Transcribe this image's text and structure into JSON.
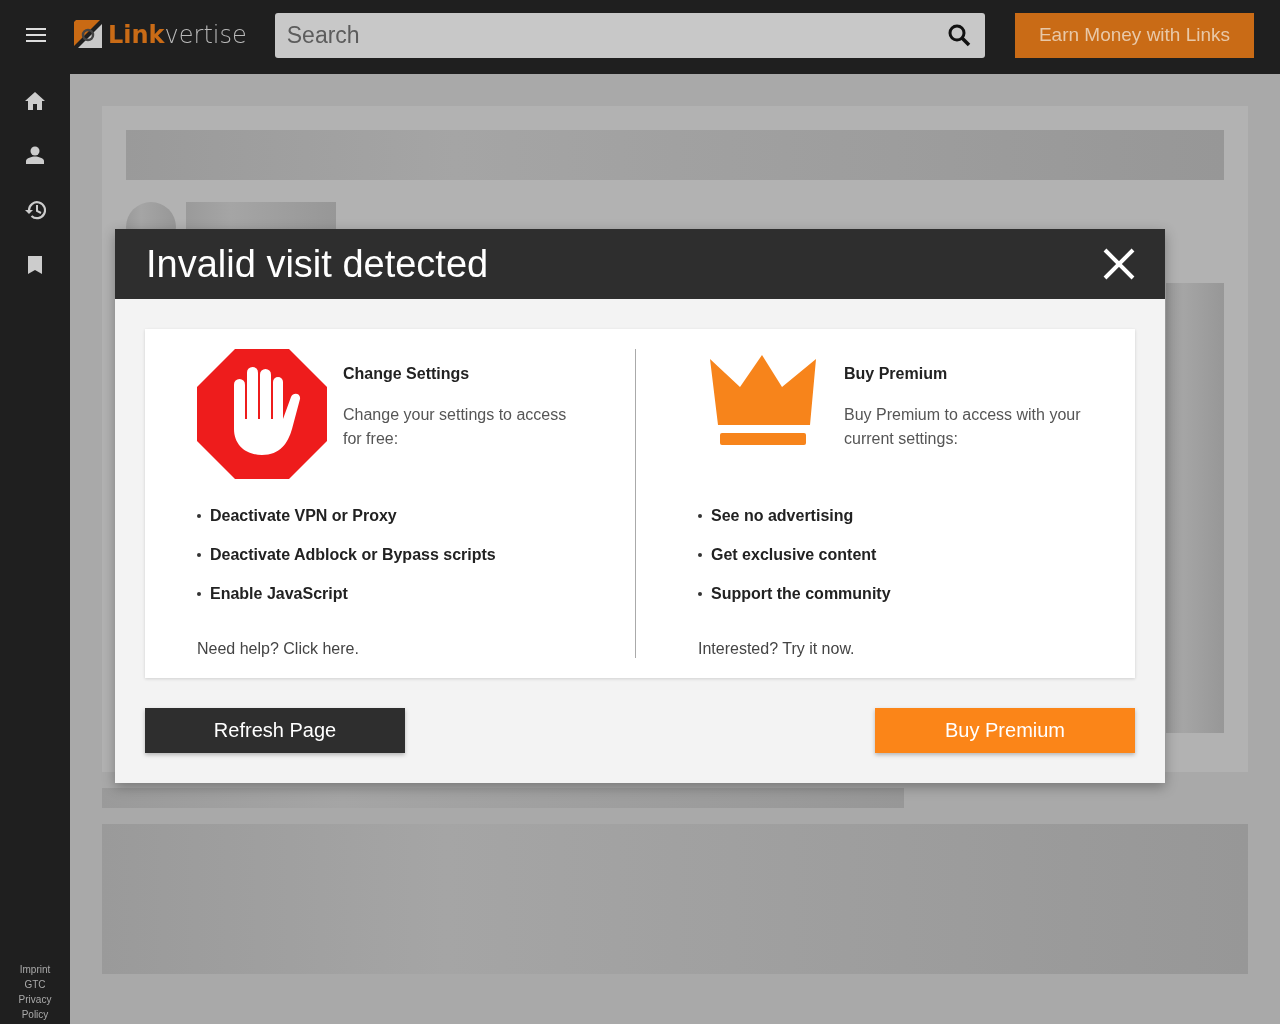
{
  "header": {
    "logo": "**Link**vertise",
    "search": {
      "placeholder": "Search"
    },
    "cta": "Earn Money with Links"
  },
  "sidebar": {
    "items": [
      {
        "kind": "home"
      },
      {
        "kind": "profile"
      },
      {
        "kind": "history"
      },
      {
        "kind": "bookmark"
      }
    ],
    "footer_links": [
      "Imprint",
      "GTC",
      "Privacy Policy"
    ]
  },
  "dialog": {
    "title": "Invalid visit detected",
    "options": [
      {
        "kind": "stop",
        "heading": "Change Settings",
        "text": "Change your settings to access for free:",
        "bullets": [
          "Deactivate VPN or Proxy",
          "Deactivate Adblock or Bypass scripts",
          "Enable JavaScript"
        ],
        "footer": "Need help? Click here."
      },
      {
        "kind": "crown",
        "heading": "Buy Premium",
        "text": "Buy Premium to access with your current settings:",
        "bullets": [
          "See no advertising",
          "Get exclusive content",
          "Support the community"
        ],
        "footer": "Interested? Try it now."
      }
    ],
    "buttons": [
      {
        "kind": "dark",
        "label": "Refresh Page"
      },
      {
        "kind": "accent",
        "label": "Buy Premium"
      }
    ]
  }
}
